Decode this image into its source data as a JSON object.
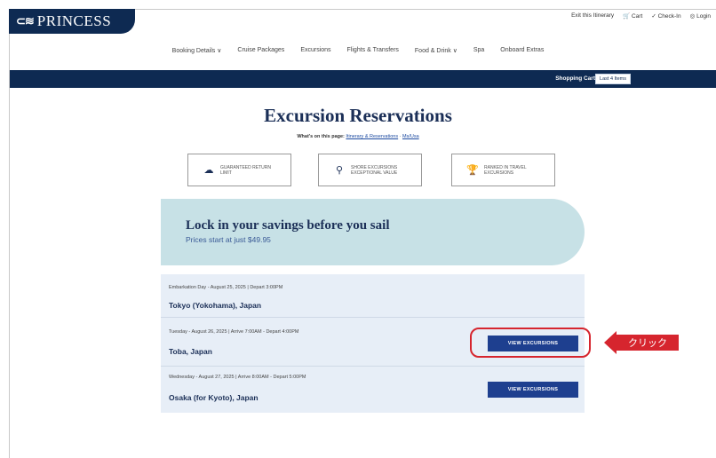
{
  "header": {
    "logo_mark": "⊂≋",
    "logo_text": "PRINCESS",
    "utility_links": [
      "Exit this Itinerary",
      "Cart",
      "Check-In",
      "Login"
    ]
  },
  "nav": {
    "items": [
      "Booking Details ∨",
      "Cruise Packages",
      "Excursions",
      "Flights & Transfers",
      "Food & Drink ∨",
      "Spa",
      "Onboard Extras"
    ]
  },
  "cart_bar": {
    "label": "Shopping Cart",
    "button": "Last 4 Items"
  },
  "page": {
    "title": "Excursion Reservations",
    "subtitle_prefix": "What's on this page:",
    "subtitle_link1": "Itinerary & Reservations",
    "subtitle_link2": "Ms/Usa"
  },
  "features": [
    {
      "icon": "cloud-icon",
      "text": "GUARANTEED RETURN LIMIT"
    },
    {
      "icon": "pin-icon",
      "text": "SHORE EXCURSIONS EXCEPTIONAL VALUE"
    },
    {
      "icon": "trophy-icon",
      "text": "RANKED IN TRAVEL EXCURSIONS"
    }
  ],
  "banner": {
    "title": "Lock in your savings before you sail",
    "subtitle": "Prices start at just $49.95"
  },
  "ports": [
    {
      "meta": "Embarkation Day - August 25, 2025 | Depart 3:00PM",
      "name": "Tokyo (Yokohama), Japan",
      "button": ""
    },
    {
      "meta": "Tuesday - August 26, 2025 | Arrive 7:00AM - Depart 4:00PM",
      "name": "Toba, Japan",
      "button": "VIEW EXCURSIONS"
    },
    {
      "meta": "Wednesday - August 27, 2025 | Arrive 8:00AM - Depart 5:00PM",
      "name": "Osaka (for Kyoto), Japan",
      "button": "VIEW EXCURSIONS"
    }
  ],
  "annotation": {
    "label": "クリック",
    "color": "#d6252e"
  },
  "colors": {
    "navy": "#0e2a52",
    "banner": "#c7e1e6",
    "button": "#1e3f8f"
  }
}
